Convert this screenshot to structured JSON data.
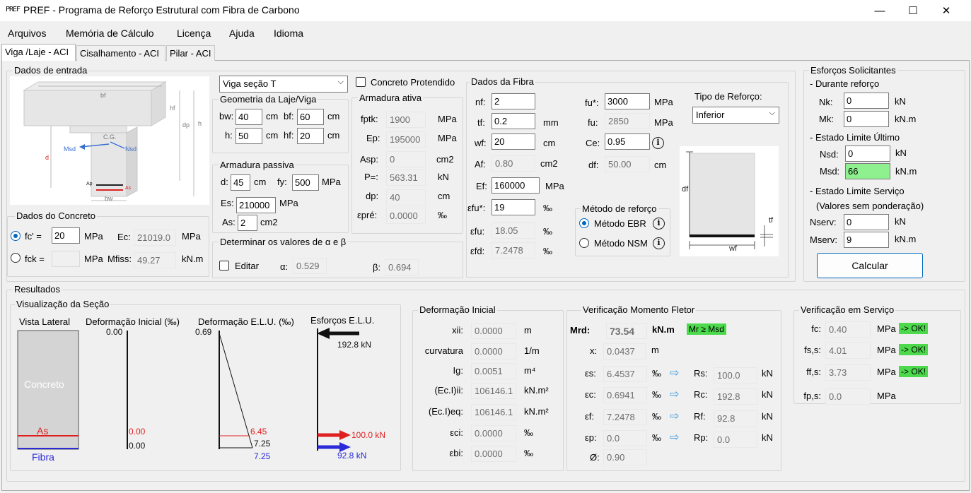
{
  "window": {
    "logo": "PREF",
    "title": "PREF - Programa de Reforço Estrutural com Fibra de Carbono",
    "minimize": "—",
    "maximize": "☐",
    "close": "✕"
  },
  "menu": [
    "Arquivos",
    "Memória de Cálculo",
    "Licença",
    "Ajuda",
    "Idioma"
  ],
  "tabs": [
    "Viga /Laje - ACI",
    "Cisalhamento - ACI",
    "Pilar - ACI"
  ],
  "entrada": {
    "title": "Dados de entrada",
    "diagram": {
      "bf": "bf",
      "hf": "hf",
      "dp": "dp",
      "h": "h",
      "d": "d",
      "cg": "C.G.",
      "msd": "Msd",
      "nsd": "Nsd",
      "ap": "Ap",
      "as": "As",
      "bw": "bw"
    },
    "tipo_secao": "Viga seção T",
    "concreto_protendido": "Concreto Protendido",
    "geometria": {
      "title": "Geometria da Laje/Viga",
      "bw_label": "bw:",
      "bw": "40",
      "bf_label": "bf:",
      "bf": "60",
      "h_label": "h:",
      "h": "50",
      "hf_label": "hf:",
      "hf": "20",
      "unit": "cm"
    },
    "passiva": {
      "title": "Armadura passiva",
      "d_label": "d:",
      "d": "45",
      "d_unit": "cm",
      "fy_label": "fy:",
      "fy": "500",
      "fy_unit": "MPa",
      "es_label": "Es:",
      "es": "210000",
      "es_unit": "MPa",
      "as_label": "As:",
      "as": "2",
      "as_unit": "cm2"
    },
    "alpha_beta": {
      "title": "Determinar os valores de α e β",
      "editar": "Editar",
      "alpha_label": "α:",
      "alpha": "0.529",
      "beta_label": "β:",
      "beta": "0.694"
    },
    "ativa": {
      "title": "Armadura ativa",
      "fptk_label": "fptk:",
      "fptk": "1900",
      "fptk_unit": "MPa",
      "ep_label": "Ep:",
      "ep": "195000",
      "ep_unit": "MPa",
      "asp_label": "Asp:",
      "asp": "0",
      "asp_unit": "cm2",
      "p_label": "P=:",
      "p": "563.31",
      "p_unit": "kN",
      "dp_label": "dp:",
      "dp": "40",
      "dp_unit": "cm",
      "epre_label": "εpré:",
      "epre": "0.0000",
      "epre_unit": "‰"
    },
    "concreto": {
      "title": "Dados do Concreto",
      "fc_label": "fc' =",
      "fc": "20",
      "fc_unit": "MPa",
      "ec_label": "Ec:",
      "ec": "21019.0",
      "ec_unit": "MPa",
      "fck_label": "fck =",
      "fck": "",
      "fck_unit": "MPa",
      "mfiss_label": "Mfiss:",
      "mfiss": "49.27",
      "mfiss_unit": "kN.m"
    },
    "fibra": {
      "title": "Dados da Fibra",
      "nf_label": "nf:",
      "nf": "2",
      "tf_label": "tf:",
      "tf": "0.2",
      "tf_unit": "mm",
      "wf_label": "wf:",
      "wf": "20",
      "wf_unit": "cm",
      "af_label": "Af:",
      "af": "0.80",
      "af_unit": "cm2",
      "ef_label": "Ef:",
      "ef": "160000",
      "ef_unit": "MPa",
      "efu_star_label": "εfu*:",
      "efu_star": "19",
      "efu_star_unit": "‰",
      "efu_label": "εfu:",
      "efu": "18.05",
      "efu_unit": "‰",
      "efd_label": "εfd:",
      "efd": "7.2478",
      "efd_unit": "‰",
      "fu_star_label": "fu*:",
      "fu_star": "3000",
      "fu_star_unit": "MPa",
      "fu_label": "fu:",
      "fu": "2850",
      "fu_unit": "MPa",
      "ce_label": "Ce:",
      "ce": "0.95",
      "df_label": "df:",
      "df": "50.00",
      "df_unit": "cm",
      "tipo_label": "Tipo de Reforço:",
      "tipo": "Inferior",
      "metodo_title": "Método de reforço",
      "ebr": "Método EBR",
      "nsm": "Método NSM",
      "diagram": {
        "df": "df",
        "tf": "tf",
        "wf": "wf"
      }
    }
  },
  "esforcos": {
    "title": "Esforços Solicitantes",
    "durante": "- Durante reforço",
    "nk_label": "Nk:",
    "nk": "0",
    "nk_unit": "kN",
    "mk_label": "Mk:",
    "mk": "0",
    "mk_unit": "kN.m",
    "elu": "- Estado Limite Último",
    "nsd_label": "Nsd:",
    "nsd": "0",
    "nsd_unit": "kN",
    "msd_label": "Msd:",
    "msd": "66",
    "msd_unit": "kN.m",
    "els": "- Estado Limite Serviço",
    "sem_pond": "(Valores sem ponderação)",
    "nserv_label": "Nserv:",
    "nserv": "0",
    "nserv_unit": "kN",
    "mserv_label": "Mserv:",
    "mserv": "9",
    "mserv_unit": "kN.m",
    "calcular": "Calcular"
  },
  "resultados": {
    "title": "Resultados",
    "vis": {
      "title": "Visualização da Seção",
      "vista": "Vista Lateral",
      "concreto": "Concreto",
      "as": "As",
      "fibra": "Fibra",
      "def_ini": "Deformação Inicial (‰)",
      "di_top": "0.00",
      "di_as": "0.00",
      "di_f": "0.00",
      "def_elu": "Deformação E.L.U. (‰)",
      "de_top": "0.69",
      "de_as": "6.45",
      "de_b": "7.25",
      "de_f": "7.25",
      "esf": "Esforços E.L.U.",
      "rc": "192.8 kN",
      "rs": "100.0 kN",
      "rf": "92.8 kN"
    },
    "def_inicial": {
      "title": "Deformação Inicial",
      "rows": [
        {
          "label": "xii:",
          "value": "0.0000",
          "unit": "m"
        },
        {
          "label": "curvatura",
          "value": "0.0000",
          "unit": "1/m"
        },
        {
          "label": "Ig:",
          "value": "0.0051",
          "unit": "m⁴"
        },
        {
          "label": "(Ec.I)ii:",
          "value": "106146.1",
          "unit": "kN.m²"
        },
        {
          "label": "(Ec.I)eq:",
          "value": "106146.1",
          "unit": "kN.m²"
        },
        {
          "label": "εci:",
          "value": "0.0000",
          "unit": "‰"
        },
        {
          "label": "εbi:",
          "value": "0.0000",
          "unit": "‰"
        }
      ]
    },
    "momento": {
      "title": "Verificação Momento Fletor",
      "mrd_label": "Mrd:",
      "mrd": "73.54",
      "mrd_unit": "kN.m",
      "check": "Mr ≥ Msd",
      "x_label": "x:",
      "x": "0.0437",
      "x_unit": "m",
      "rows": [
        {
          "label": "εs:",
          "value": "6.4537",
          "unit": "‰",
          "rlabel": "Rs:",
          "rvalue": "100.0",
          "runit": "kN"
        },
        {
          "label": "εc:",
          "value": "0.6941",
          "unit": "‰",
          "rlabel": "Rc:",
          "rvalue": "192.8",
          "runit": "kN"
        },
        {
          "label": "εf:",
          "value": "7.2478",
          "unit": "‰",
          "rlabel": "Rf:",
          "rvalue": "92.8",
          "runit": "kN"
        },
        {
          "label": "εp:",
          "value": "0.0",
          "unit": "‰",
          "rlabel": "Rp:",
          "rvalue": "0.0",
          "runit": "kN"
        }
      ],
      "phi_label": "Ø:",
      "phi": "0.90"
    },
    "servico": {
      "title": "Verificação em Serviço",
      "rows": [
        {
          "label": "fc:",
          "value": "0.40",
          "unit": "MPa",
          "ok": "-> OK!"
        },
        {
          "label": "fs,s:",
          "value": "4.01",
          "unit": "MPa",
          "ok": "-> OK!"
        },
        {
          "label": "ff,s:",
          "value": "3.73",
          "unit": "MPa",
          "ok": "-> OK!"
        },
        {
          "label": "fp,s:",
          "value": "0.0",
          "unit": "MPa",
          "ok": ""
        }
      ]
    }
  }
}
